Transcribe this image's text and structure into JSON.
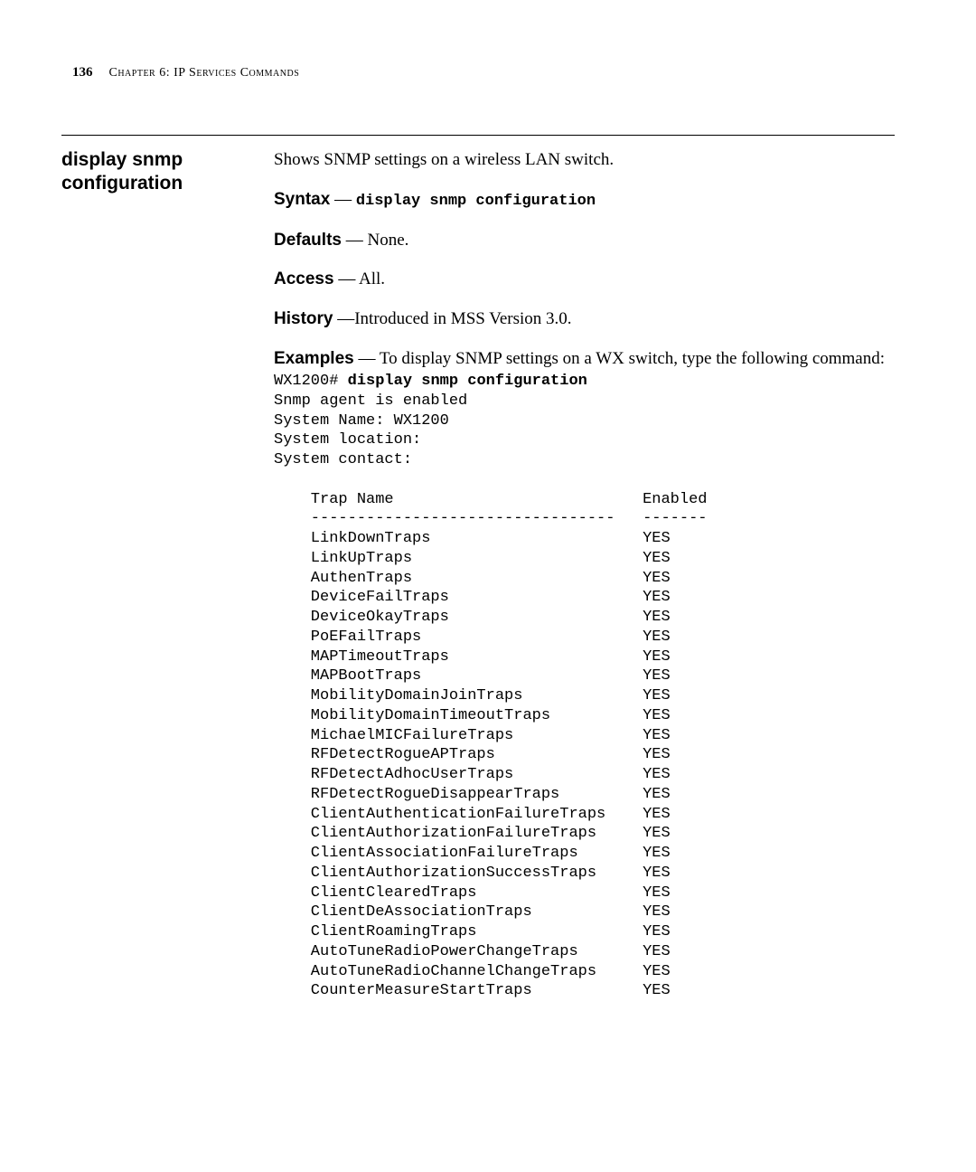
{
  "header": {
    "page_number": "136",
    "chapter_label": "Chapter 6: IP Services Commands"
  },
  "left": {
    "command_title_line1": "display snmp",
    "command_title_line2": "configuration"
  },
  "right": {
    "intro": "Shows SNMP settings on a wireless LAN switch.",
    "syntax_label": "Syntax",
    "syntax_sep": " — ",
    "syntax_cmd": "display snmp configuration",
    "defaults_label": "Defaults",
    "defaults_text": " — None.",
    "access_label": "Access",
    "access_text": " — All.",
    "history_label": "History",
    "history_text": " —Introduced in MSS Version 3.0.",
    "examples_label": "Examples",
    "examples_text": " — To display SNMP settings on a WX switch, type the following command:",
    "example_prompt": "WX1200# ",
    "example_cmd": "display snmp configuration",
    "example_preamble": "Snmp agent is enabled\nSystem Name: WX1200\nSystem location:\nSystem contact:\n",
    "trap_table": "    Trap Name                           Enabled\n    ---------------------------------   -------\n    LinkDownTraps                       YES\n    LinkUpTraps                         YES\n    AuthenTraps                         YES\n    DeviceFailTraps                     YES\n    DeviceOkayTraps                     YES\n    PoEFailTraps                        YES\n    MAPTimeoutTraps                     YES\n    MAPBootTraps                        YES\n    MobilityDomainJoinTraps             YES\n    MobilityDomainTimeoutTraps          YES\n    MichaelMICFailureTraps              YES\n    RFDetectRogueAPTraps                YES\n    RFDetectAdhocUserTraps              YES\n    RFDetectRogueDisappearTraps         YES\n    ClientAuthenticationFailureTraps    YES\n    ClientAuthorizationFailureTraps     YES\n    ClientAssociationFailureTraps       YES\n    ClientAuthorizationSuccessTraps     YES\n    ClientClearedTraps                  YES\n    ClientDeAssociationTraps            YES\n    ClientRoamingTraps                  YES\n    AutoTuneRadioPowerChangeTraps       YES\n    AutoTuneRadioChannelChangeTraps     YES\n    CounterMeasureStartTraps            YES"
  }
}
